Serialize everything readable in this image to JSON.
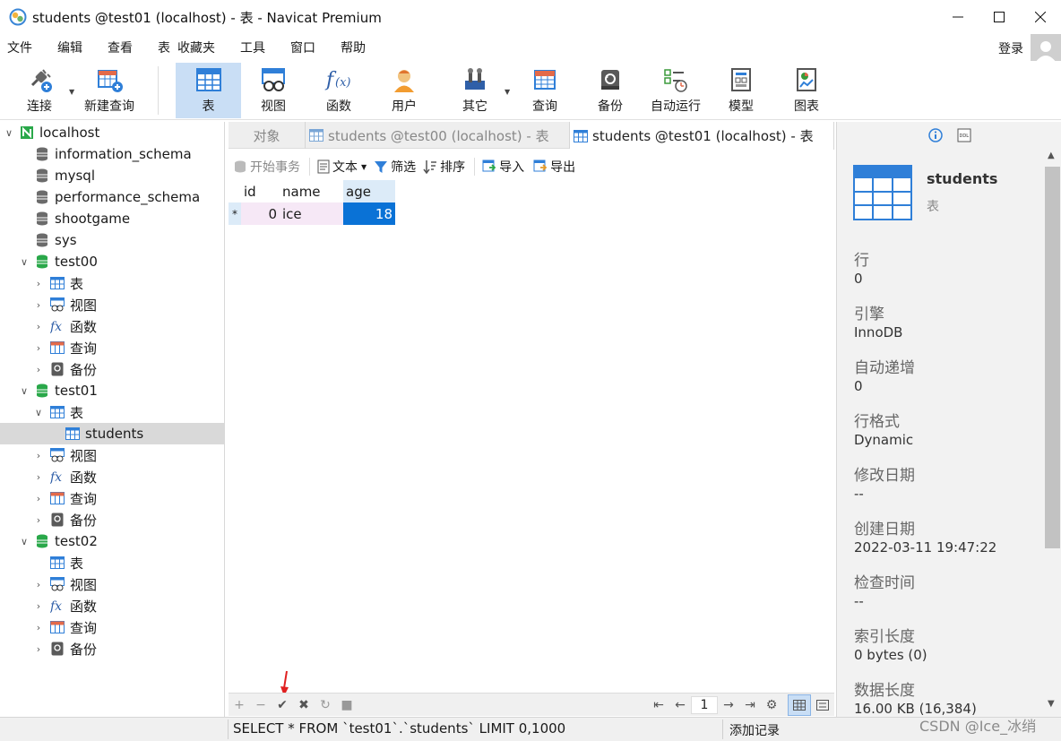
{
  "window": {
    "title": "students @test01 (localhost) - 表 - Navicat Premium"
  },
  "menu": {
    "items": [
      "文件",
      "编辑",
      "查看",
      "表",
      "收藏夹",
      "工具",
      "窗口",
      "帮助"
    ],
    "login": "登录"
  },
  "toolbar": {
    "items": [
      {
        "label": "连接",
        "icon": "plug-icon"
      },
      {
        "label": "新建查询",
        "icon": "new-query-icon"
      },
      {
        "label": "表",
        "icon": "table-icon",
        "active": true
      },
      {
        "label": "视图",
        "icon": "view-icon"
      },
      {
        "label": "函数",
        "icon": "function-icon"
      },
      {
        "label": "用户",
        "icon": "user-icon"
      },
      {
        "label": "其它",
        "icon": "tools-icon"
      },
      {
        "label": "查询",
        "icon": "query-icon"
      },
      {
        "label": "备份",
        "icon": "backup-icon"
      },
      {
        "label": "自动运行",
        "icon": "schedule-icon"
      },
      {
        "label": "模型",
        "icon": "model-icon"
      },
      {
        "label": "图表",
        "icon": "chart-icon"
      }
    ]
  },
  "tree": {
    "connection": "localhost",
    "databases": [
      "information_schema",
      "mysql",
      "performance_schema",
      "shootgame",
      "sys"
    ],
    "test00": {
      "name": "test00",
      "children": [
        "表",
        "视图",
        "函数",
        "查询",
        "备份"
      ]
    },
    "test01": {
      "name": "test01",
      "table_folder": "表",
      "table": "students",
      "children": [
        "视图",
        "函数",
        "查询",
        "备份"
      ]
    },
    "test02": {
      "name": "test02",
      "children": [
        "表",
        "视图",
        "函数",
        "查询",
        "备份"
      ]
    }
  },
  "tabs": {
    "objects": "对象",
    "tab1": "students @test00 (localhost) - 表",
    "tab2": "students @test01 (localhost) - 表"
  },
  "subtoolbar": {
    "begin_tx": "开始事务",
    "text": "文本",
    "filter": "筛选",
    "sort": "排序",
    "import": "导入",
    "export": "导出"
  },
  "grid": {
    "columns": [
      "id",
      "name",
      "age"
    ],
    "row_marker": "*",
    "rows": [
      {
        "id": "0",
        "name": "ice",
        "age": "18"
      }
    ]
  },
  "gridbar": {
    "page": "1"
  },
  "info": {
    "name": "students",
    "type": "表",
    "props": [
      {
        "label": "行",
        "value": "0"
      },
      {
        "label": "引擎",
        "value": "InnoDB"
      },
      {
        "label": "自动递增",
        "value": "0"
      },
      {
        "label": "行格式",
        "value": "Dynamic"
      },
      {
        "label": "修改日期",
        "value": "--"
      },
      {
        "label": "创建日期",
        "value": "2022-03-11 19:47:22"
      },
      {
        "label": "检查时间",
        "value": "--"
      },
      {
        "label": "索引长度",
        "value": "0 bytes (0)"
      },
      {
        "label": "数据长度",
        "value": "16.00 KB (16,384)"
      }
    ]
  },
  "status": {
    "sql": "SELECT * FROM `test01`.`students` LIMIT 0,1000",
    "add_record": "添加记录",
    "watermark": "CSDN @Ice_冰绡"
  },
  "colors": {
    "accent": "#0a72d6",
    "selection": "#c9def5",
    "db_green": "#2aa84a"
  }
}
